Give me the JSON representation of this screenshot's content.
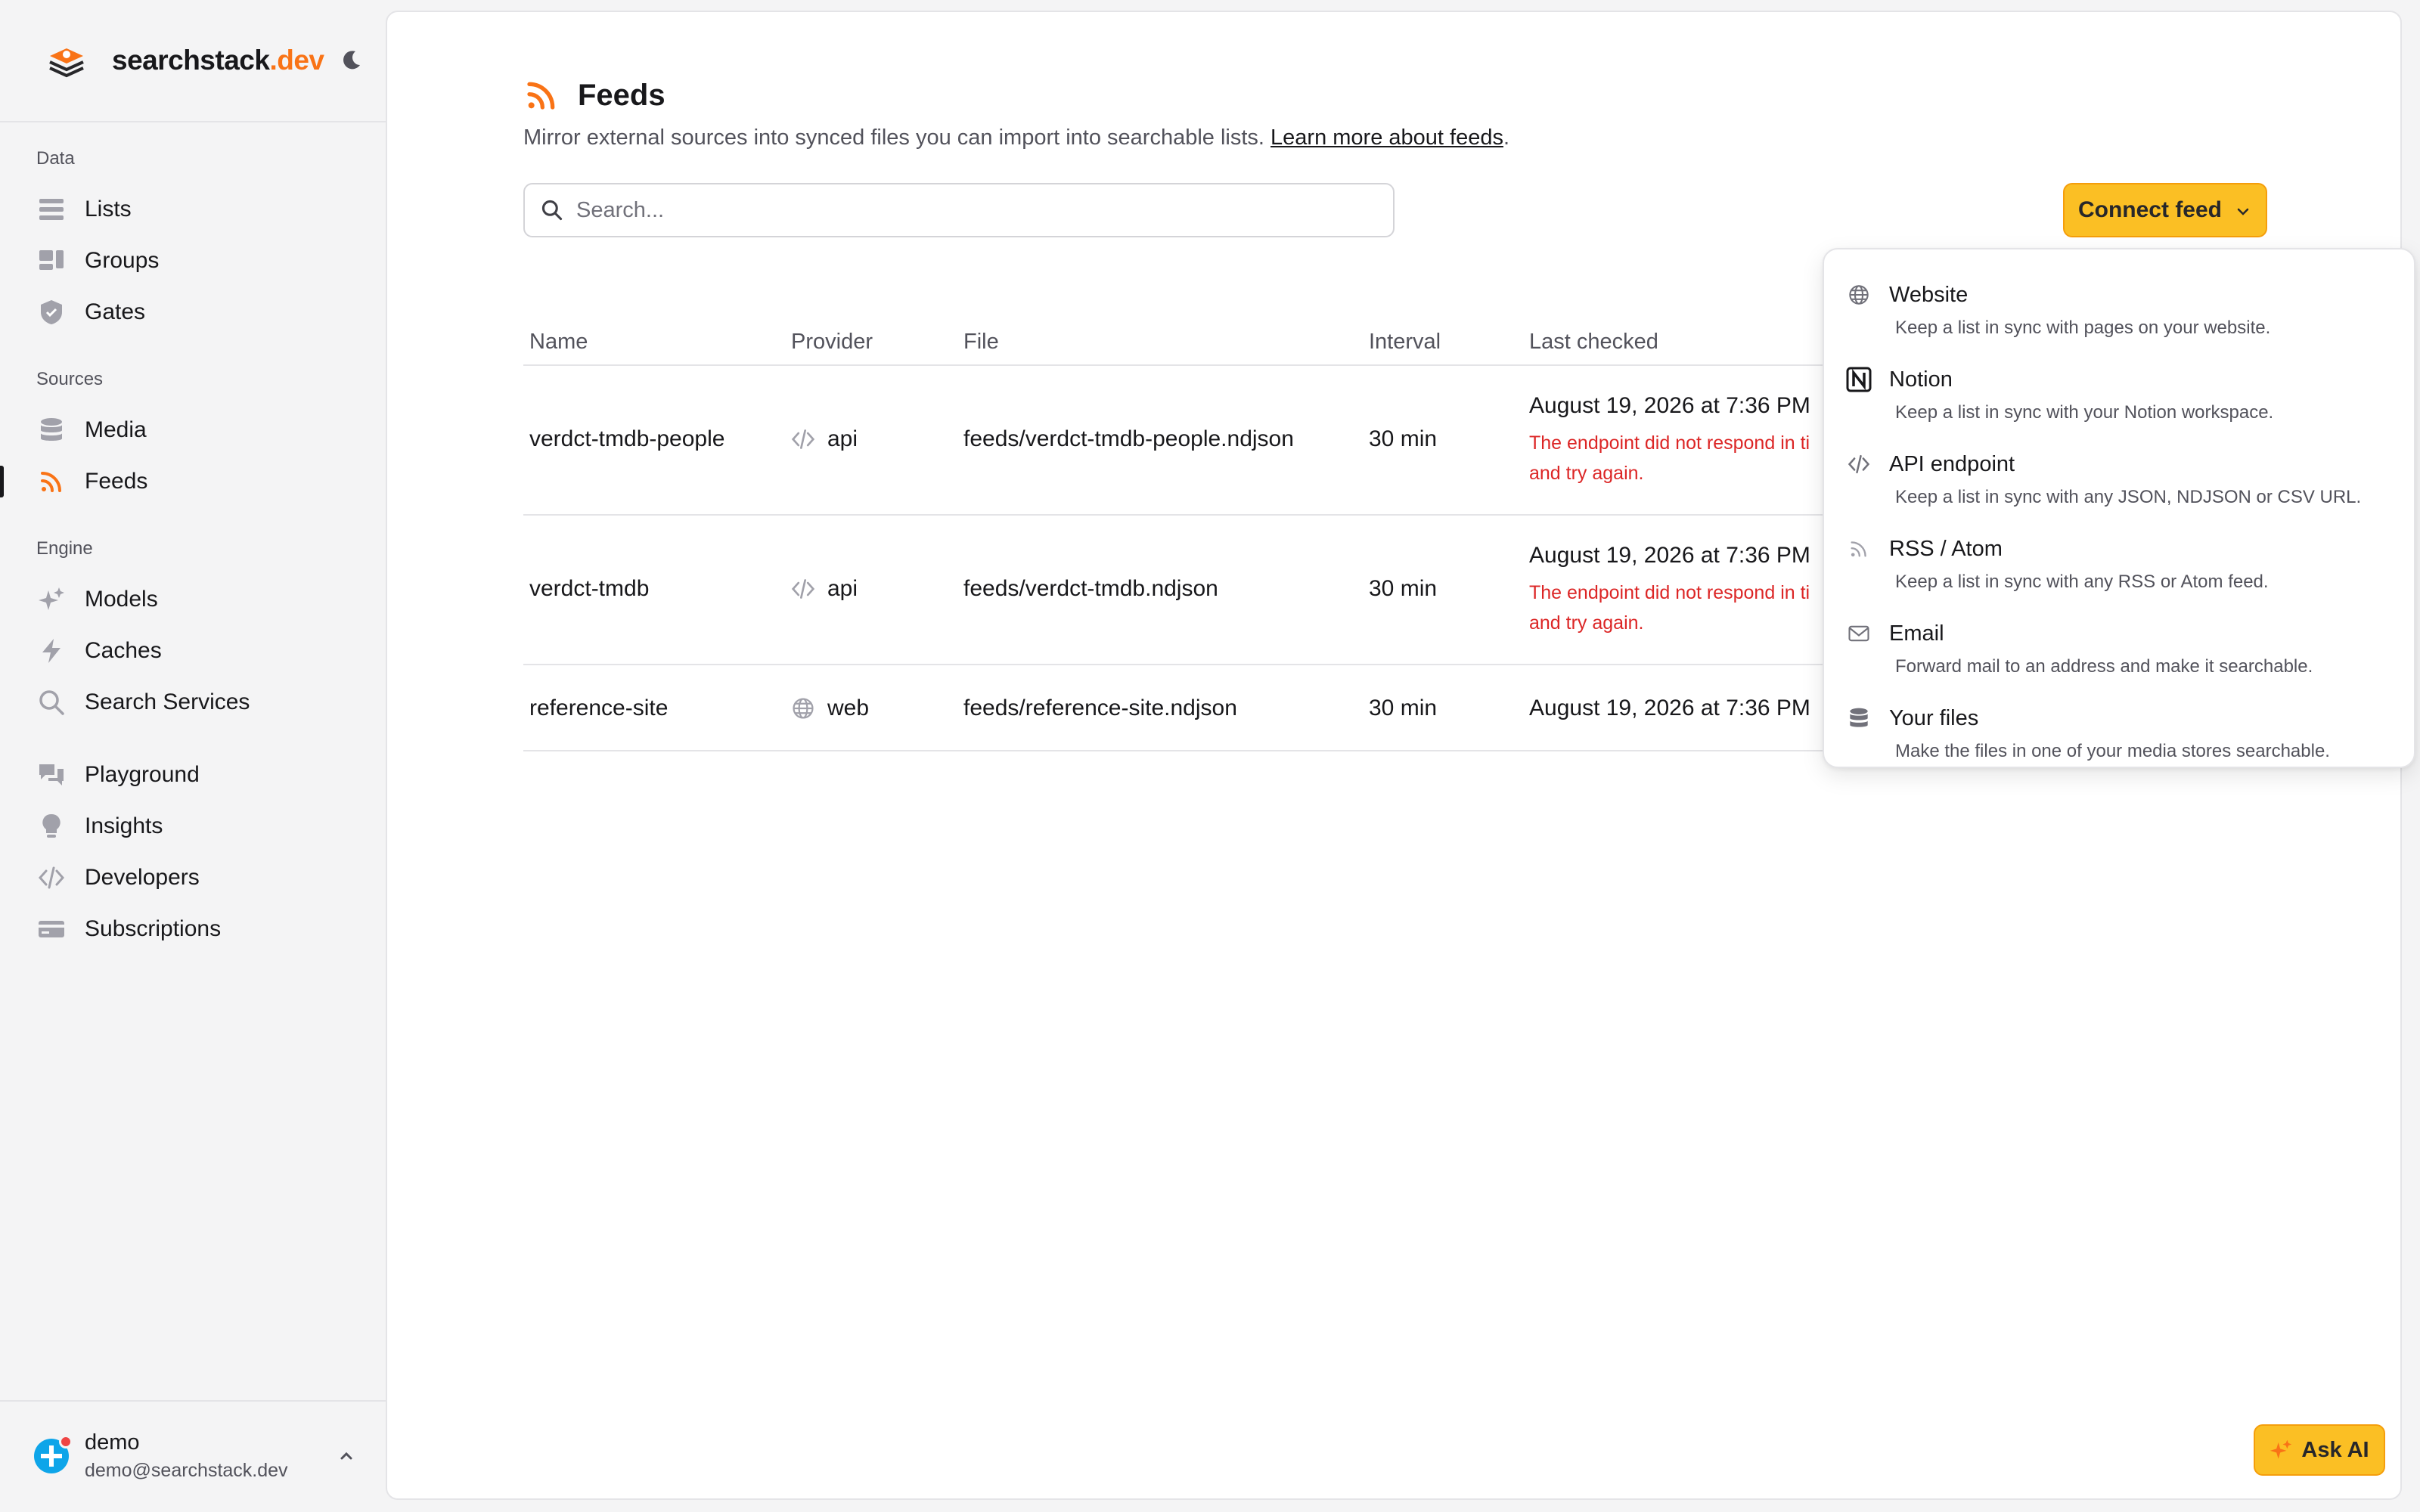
{
  "brand": {
    "name": "searchstack",
    "tld": ".dev"
  },
  "colors": {
    "accent": "#f97316",
    "button": "#fbbf24",
    "error": "#dc2626"
  },
  "sidebar": {
    "sections": [
      {
        "label": "Data",
        "items": [
          {
            "label": "Lists",
            "icon": "list-icon"
          },
          {
            "label": "Groups",
            "icon": "groups-icon"
          },
          {
            "label": "Gates",
            "icon": "shield-icon"
          }
        ]
      },
      {
        "label": "Sources",
        "items": [
          {
            "label": "Media",
            "icon": "database-icon"
          },
          {
            "label": "Feeds",
            "icon": "rss-icon",
            "active": true
          }
        ]
      },
      {
        "label": "Engine",
        "items": [
          {
            "label": "Models",
            "icon": "sparkles-icon"
          },
          {
            "label": "Caches",
            "icon": "bolt-icon"
          },
          {
            "label": "Search Services",
            "icon": "search-icon"
          }
        ]
      },
      {
        "label": "",
        "items": [
          {
            "label": "Playground",
            "icon": "chat-icon"
          },
          {
            "label": "Insights",
            "icon": "lightbulb-icon"
          },
          {
            "label": "Developers",
            "icon": "code-icon"
          },
          {
            "label": "Subscriptions",
            "icon": "card-icon"
          }
        ]
      }
    ],
    "user": {
      "name": "demo",
      "email": "demo@searchstack.dev"
    }
  },
  "page": {
    "title": "Feeds",
    "subtitle": "Mirror external sources into synced files you can import into searchable lists.",
    "learn_more": "Learn more about feeds",
    "period": "."
  },
  "search": {
    "placeholder": "Search..."
  },
  "connect_button": {
    "label": "Connect feed"
  },
  "table": {
    "columns": [
      "Name",
      "Provider",
      "File",
      "Interval",
      "Last checked"
    ],
    "rows": [
      {
        "name": "verdct-tmdb-people",
        "provider": "api",
        "provider_icon": "code-icon",
        "file": "feeds/verdct-tmdb-people.ndjson",
        "interval": "30 min",
        "last_checked": "August 19, 2026 at 7:36 PM",
        "error_line1": "The endpoint did not respond in ti",
        "error_line2": "and try again."
      },
      {
        "name": "verdct-tmdb",
        "provider": "api",
        "provider_icon": "code-icon",
        "file": "feeds/verdct-tmdb.ndjson",
        "interval": "30 min",
        "last_checked": "August 19, 2026 at 7:36 PM",
        "error_line1": "The endpoint did not respond in ti",
        "error_line2": "and try again."
      },
      {
        "name": "reference-site",
        "provider": "web",
        "provider_icon": "globe-icon",
        "file": "feeds/reference-site.ndjson",
        "interval": "30 min",
        "last_checked": "August 19, 2026 at 7:36 PM"
      }
    ]
  },
  "dropdown": {
    "items": [
      {
        "title": "Website",
        "desc": "Keep a list in sync with pages on your website.",
        "icon": "globe-icon"
      },
      {
        "title": "Notion",
        "desc": "Keep a list in sync with your Notion workspace.",
        "icon": "notion-icon"
      },
      {
        "title": "API endpoint",
        "desc": "Keep a list in sync with any JSON, NDJSON or CSV URL.",
        "icon": "code-icon"
      },
      {
        "title": "RSS / Atom",
        "desc": "Keep a list in sync with any RSS or Atom feed.",
        "icon": "rss-icon"
      },
      {
        "title": "Email",
        "desc": "Forward mail to an address and make it searchable.",
        "icon": "mail-icon"
      },
      {
        "title": "Your files",
        "desc": "Make the files in one of your media stores searchable.",
        "icon": "database-icon"
      }
    ]
  },
  "ask_ai": {
    "label": "Ask AI"
  }
}
